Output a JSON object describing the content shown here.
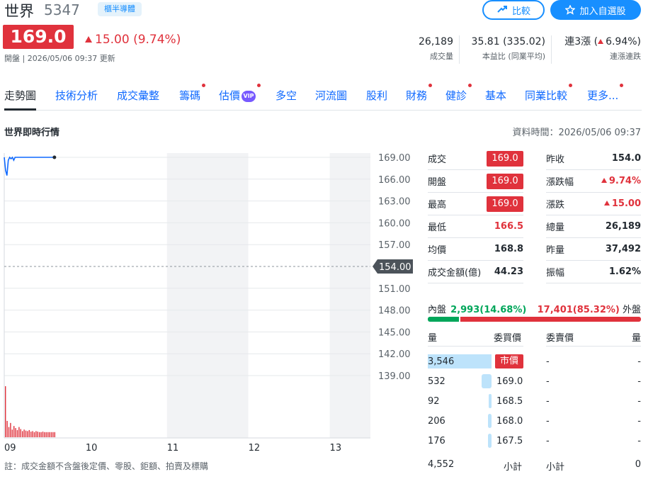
{
  "stock": {
    "name": "世界",
    "code": "5347",
    "market_tag": "櫃半導體",
    "price": "169.0",
    "change": "15.00 (9.74%)",
    "update_line": "開盤 | 2026/05/06 09:37 更新"
  },
  "buttons": {
    "compare": "比較",
    "add_watchlist": "加入自選股"
  },
  "header_stats": [
    {
      "value": "26,189",
      "label": "成交量"
    },
    {
      "value": "35.81 (335.02)",
      "label": "本益比 (同業平均)"
    },
    {
      "value_prefix": "連3漲 (",
      "value_change": "6.94%)",
      "label": "連漲連跌"
    }
  ],
  "tabs": [
    {
      "label": "走勢圖",
      "dot": false,
      "active": true
    },
    {
      "label": "技術分析",
      "dot": false
    },
    {
      "label": "成交彙整",
      "dot": false
    },
    {
      "label": "籌碼",
      "dot": true
    },
    {
      "label": "估價",
      "dot": true,
      "badge": "VIP"
    },
    {
      "label": "多空",
      "dot": false
    },
    {
      "label": "河流圖",
      "dot": false
    },
    {
      "label": "股利",
      "dot": false
    },
    {
      "label": "財務",
      "dot": true
    },
    {
      "label": "健診",
      "dot": true
    },
    {
      "label": "基本",
      "dot": false
    },
    {
      "label": "同業比較",
      "dot": true
    },
    {
      "label": "更多...",
      "dot": true
    }
  ],
  "section": {
    "title": "世界即時行情",
    "data_time": "資料時間：2026/05/06 09:37"
  },
  "chart_data": {
    "type": "line",
    "x_ticks": [
      "09",
      "10",
      "11",
      "12",
      "13"
    ],
    "y_ticks": [
      "169.00",
      "166.00",
      "163.00",
      "160.00",
      "157.00",
      "154.00",
      "151.00",
      "148.00",
      "145.00",
      "142.00",
      "139.00"
    ],
    "ylim": [
      139,
      169
    ],
    "reference_price": "154.00",
    "price_series": [
      {
        "t": "09:00",
        "v": 169.0
      },
      {
        "t": "09:01",
        "v": 167.2
      },
      {
        "t": "09:02",
        "v": 166.5
      },
      {
        "t": "09:03",
        "v": 168.6
      },
      {
        "t": "09:04",
        "v": 169.0
      },
      {
        "t": "09:05",
        "v": 168.8
      },
      {
        "t": "09:06",
        "v": 169.0
      },
      {
        "t": "09:07",
        "v": 168.6
      },
      {
        "t": "09:08",
        "v": 169.0
      },
      {
        "t": "09:10",
        "v": 169.0
      },
      {
        "t": "09:15",
        "v": 169.0
      },
      {
        "t": "09:20",
        "v": 169.0
      },
      {
        "t": "09:25",
        "v": 169.0
      },
      {
        "t": "09:30",
        "v": 169.0
      },
      {
        "t": "09:37",
        "v": 169.0
      }
    ],
    "volume_relative": [
      1.0,
      0.32,
      0.2,
      0.28,
      0.15,
      0.22,
      0.18,
      0.14,
      0.2,
      0.16,
      0.12,
      0.15,
      0.13,
      0.12,
      0.14,
      0.11,
      0.12,
      0.1,
      0.12,
      0.11,
      0.1,
      0.1,
      0.11,
      0.1,
      0.1,
      0.1,
      0.1,
      0.1,
      0.1,
      0.1
    ],
    "colors": {
      "line": "#0f69ff",
      "volume": "#e0323c",
      "shade": "#f2f3f5"
    }
  },
  "quote_left": [
    {
      "label": "成交",
      "value": "169.0",
      "style": "box"
    },
    {
      "label": "開盤",
      "value": "169.0",
      "style": "box"
    },
    {
      "label": "最高",
      "value": "169.0",
      "style": "box"
    },
    {
      "label": "最低",
      "value": "166.5",
      "style": "red"
    },
    {
      "label": "均價",
      "value": "168.8",
      "style": "plain"
    },
    {
      "label": "成交金額(億)",
      "value": "44.23",
      "style": "plain"
    }
  ],
  "quote_right": [
    {
      "label": "昨收",
      "value": "154.0",
      "style": "plain"
    },
    {
      "label": "漲跌幅",
      "value": "9.74%",
      "style": "up"
    },
    {
      "label": "漲跌",
      "value": "15.00",
      "style": "up"
    },
    {
      "label": "總量",
      "value": "26,189",
      "style": "plain"
    },
    {
      "label": "昨量",
      "value": "37,492",
      "style": "plain"
    },
    {
      "label": "振幅",
      "value": "1.62%",
      "style": "plain"
    }
  ],
  "inout": {
    "inner_label": "內盤",
    "inner_value": "2,993(14.68%)",
    "outer_value": "17,401(85.32%)",
    "outer_label": "外盤",
    "inner_ratio": 0.1468
  },
  "order_book": {
    "headers": {
      "bid_qty": "量",
      "bid_price": "委買價",
      "ask_price": "委賣價",
      "ask_qty": "量"
    },
    "rows": [
      {
        "bid_qty": "3,546",
        "bid_price": "市價",
        "ask_price": "-",
        "ask_qty": "-",
        "ratio": 1.0,
        "market": true
      },
      {
        "bid_qty": "532",
        "bid_price": "169.0",
        "ask_price": "-",
        "ask_qty": "-",
        "ratio": 0.15
      },
      {
        "bid_qty": "92",
        "bid_price": "168.5",
        "ask_price": "-",
        "ask_qty": "-",
        "ratio": 0.026
      },
      {
        "bid_qty": "206",
        "bid_price": "168.0",
        "ask_price": "-",
        "ask_qty": "-",
        "ratio": 0.058
      },
      {
        "bid_qty": "176",
        "bid_price": "167.5",
        "ask_price": "-",
        "ask_qty": "-",
        "ratio": 0.05
      }
    ],
    "totals": {
      "bid_total": "4,552",
      "bid_label": "小計",
      "ask_label": "小計",
      "ask_total": "0"
    }
  },
  "note": "註：成交金額不含盤後定價、零股、鉅額、拍賣及標購"
}
